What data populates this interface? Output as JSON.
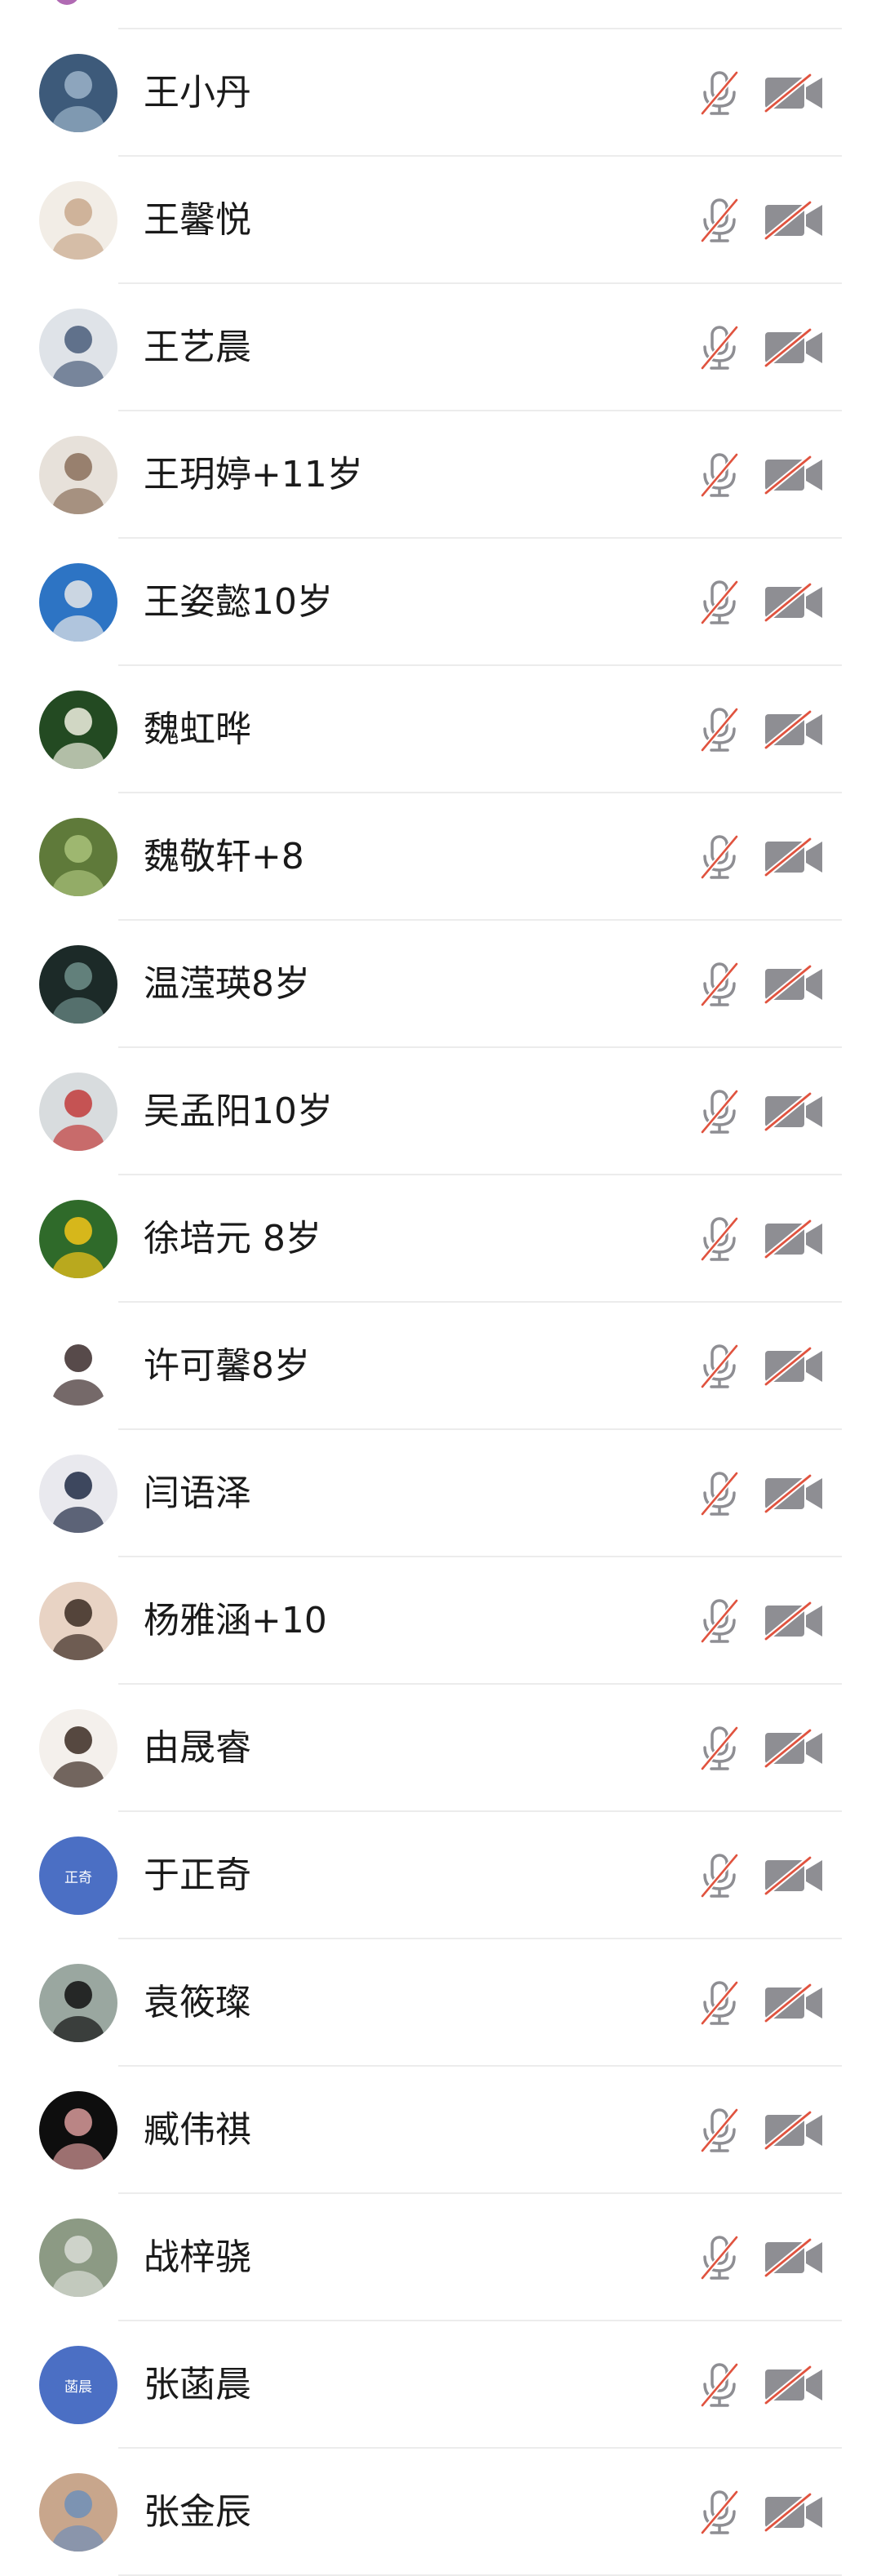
{
  "participants": [
    {
      "name": "王小丹",
      "avatar": {
        "kind": "photo",
        "bg": "#3d5a7a",
        "fg": "#9bb3c9",
        "label": ""
      }
    },
    {
      "name": "王馨悦",
      "avatar": {
        "kind": "photo",
        "bg": "#f2ede6",
        "fg": "#c9a88c",
        "label": ""
      }
    },
    {
      "name": "王艺晨",
      "avatar": {
        "kind": "photo",
        "bg": "#dfe3e8",
        "fg": "#4a5d7a",
        "label": ""
      }
    },
    {
      "name": "王玥婷+11岁",
      "avatar": {
        "kind": "photo",
        "bg": "#e7e1da",
        "fg": "#8a6f5a",
        "label": ""
      }
    },
    {
      "name": "王姿懿10岁",
      "avatar": {
        "kind": "photo",
        "bg": "#2d74c4",
        "fg": "#e8e8e8",
        "label": ""
      }
    },
    {
      "name": "魏虹晔",
      "avatar": {
        "kind": "photo",
        "bg": "#234a22",
        "fg": "#f0f0e0",
        "label": ""
      }
    },
    {
      "name": "魏敬轩+8",
      "avatar": {
        "kind": "photo",
        "bg": "#5f7a3a",
        "fg": "#a9c27a",
        "label": ""
      }
    },
    {
      "name": "温滢瑛8岁",
      "avatar": {
        "kind": "photo",
        "bg": "#1c2a28",
        "fg": "#6e8f8a",
        "label": ""
      }
    },
    {
      "name": "吴孟阳10岁",
      "avatar": {
        "kind": "photo",
        "bg": "#d8dcde",
        "fg": "#c23b3b",
        "label": ""
      }
    },
    {
      "name": "徐培元 8岁",
      "avatar": {
        "kind": "photo",
        "bg": "#2f6a2a",
        "fg": "#f3c419",
        "label": ""
      }
    },
    {
      "name": "许可馨8岁",
      "avatar": {
        "kind": "photo",
        "bg": "#ffffff",
        "fg": "#3a2a2a",
        "label": ""
      }
    },
    {
      "name": "闫语泽",
      "avatar": {
        "kind": "photo",
        "bg": "#e9e9ee",
        "fg": "#1f2a44",
        "label": ""
      }
    },
    {
      "name": "杨雅涵+10",
      "avatar": {
        "kind": "photo",
        "bg": "#e8d3c4",
        "fg": "#3a2a22",
        "label": ""
      }
    },
    {
      "name": "由晟睿",
      "avatar": {
        "kind": "photo",
        "bg": "#f4f0ec",
        "fg": "#3a2a22",
        "label": ""
      }
    },
    {
      "name": "于正奇",
      "avatar": {
        "kind": "text",
        "bg": "#4b6fc4",
        "fg": "#ffffff",
        "label": "正奇"
      }
    },
    {
      "name": "袁筱璨",
      "avatar": {
        "kind": "photo",
        "bg": "#9aa7a0",
        "fg": "#111111",
        "label": ""
      }
    },
    {
      "name": "臧伟祺",
      "avatar": {
        "kind": "photo",
        "bg": "#0e0e0e",
        "fg": "#d89a9a",
        "label": ""
      }
    },
    {
      "name": "战梓骁",
      "avatar": {
        "kind": "photo",
        "bg": "#8c9a84",
        "fg": "#d9ddd6",
        "label": ""
      }
    },
    {
      "name": "张菡晨",
      "avatar": {
        "kind": "text",
        "bg": "#4b6fc4",
        "fg": "#ffffff",
        "label": "菡晨"
      }
    },
    {
      "name": "张金辰",
      "avatar": {
        "kind": "photo",
        "bg": "#c8a68c",
        "fg": "#6f8fb8",
        "label": ""
      }
    }
  ],
  "controls": {
    "mic_icon": "microphone-muted-icon",
    "cam_icon": "camera-off-icon",
    "icon_color": "#8e8e93",
    "slash_color": "#e0533f"
  }
}
